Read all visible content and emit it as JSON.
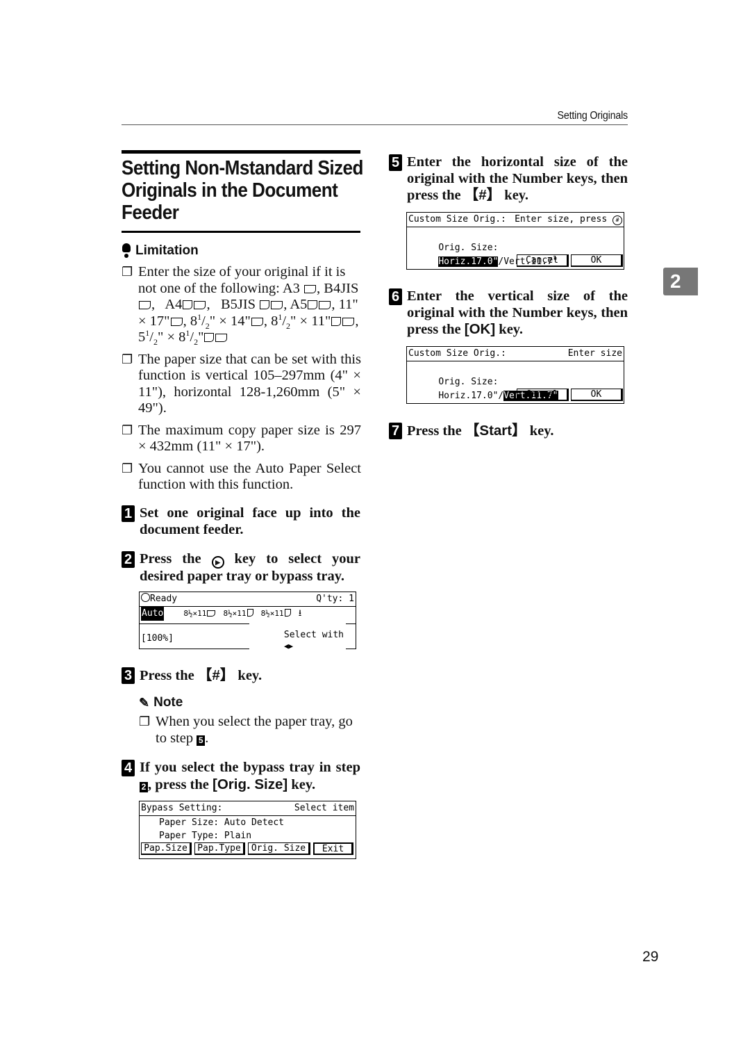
{
  "header": {
    "running_title": "Setting Originals",
    "chapter_tab": "2",
    "page_number": "29"
  },
  "section": {
    "title_lines": [
      "Setting Non-Mstandard Sized",
      "Originals in the Document",
      "Feeder"
    ]
  },
  "limitation": {
    "heading": "Limitation",
    "items": [
      {
        "text": "Enter the size of your original if it is not one of the following: A3, B4JIS, A4, B5JIS, A5, 11\" × 17\", 8½\" × 14\", 8½\" × 11\", 5½\" × 8½\"",
        "l1": "Enter the size of your original if it is not one of the following: A3",
        "l2": "B4JIS",
        "l3": "A4",
        "l4": "B5JIS",
        "l5": "A5",
        "l6": ", 11\" × 17\"",
        "l7": ", 8",
        "l8": "\" × 14\"",
        "l9": "\" × 11\"",
        "l10": ", 5",
        "l11": "\" × 8"
      },
      {
        "text": "The paper size that can be set with this function is vertical 105–297mm (4\" × 11\"), horizontal 128-1,260mm (5\" × 49\")."
      },
      {
        "text": "The maximum copy paper size is 297 × 432mm (11\" × 17\")."
      },
      {
        "text": "You cannot use the Auto Paper Select function with this function."
      }
    ]
  },
  "steps": [
    {
      "num": "1",
      "text": "Set one original face up into the document feeder."
    },
    {
      "num": "2",
      "text_before": "Press the",
      "key_glyph": "▶",
      "text_after": "key to select your desired paper tray or bypass tray."
    },
    {
      "num": "3",
      "text_before": "Press the",
      "key": "【#】",
      "text_after": "key."
    },
    {
      "num": "4",
      "text_before": "If you select the bypass tray in step",
      "ref": "2",
      "text_mid": ", press the",
      "key": "[Orig. Size]",
      "text_after": "key."
    },
    {
      "num": "5",
      "text_before": "Enter the horizontal size of the original with the Number keys, then press the",
      "key": "【#】",
      "text_after": "key."
    },
    {
      "num": "6",
      "text_before": "Enter the vertical size of the original with the Number keys, then press the",
      "key": "[OK]",
      "text_after": "key."
    },
    {
      "num": "7",
      "text_before": "Press the",
      "key": "【Start】",
      "text_after": "key."
    }
  ],
  "note": {
    "heading": "Note",
    "text_before": "When you select the paper tray, go to step",
    "ref": "5",
    "text_after": "."
  },
  "screens": {
    "ready": {
      "status": "Ready",
      "qty": "Q'ty: 1",
      "auto": "Auto",
      "trays": [
        "8½×11",
        "8½×11",
        "8½×11"
      ],
      "select_with": "Select with",
      "ratio": "[100%]"
    },
    "bypass": {
      "title": "Bypass Setting:",
      "hint": "Select item",
      "line1": "Paper Size: Auto Detect",
      "line2": "Paper Type: Plain",
      "buttons": [
        "Pap.Size",
        "Pap.Type",
        "Orig. Size",
        "Exit"
      ]
    },
    "horiz": {
      "title": "Custom Size Orig.:",
      "hint": "Enter size, press",
      "label": "Orig. Size:",
      "horiz": "Horiz.17.0\"",
      "sep": "/",
      "vert": "Vert.11.7\"",
      "cancel": "Cancel",
      "ok": "OK"
    },
    "vert": {
      "title": "Custom Size Orig.:",
      "hint": "Enter size",
      "label": "Orig. Size:",
      "horiz": "Horiz.17.0\"",
      "sep": "/",
      "vert": "Vert.11.7\"",
      "cancel": "Cancel",
      "ok": "OK"
    }
  }
}
